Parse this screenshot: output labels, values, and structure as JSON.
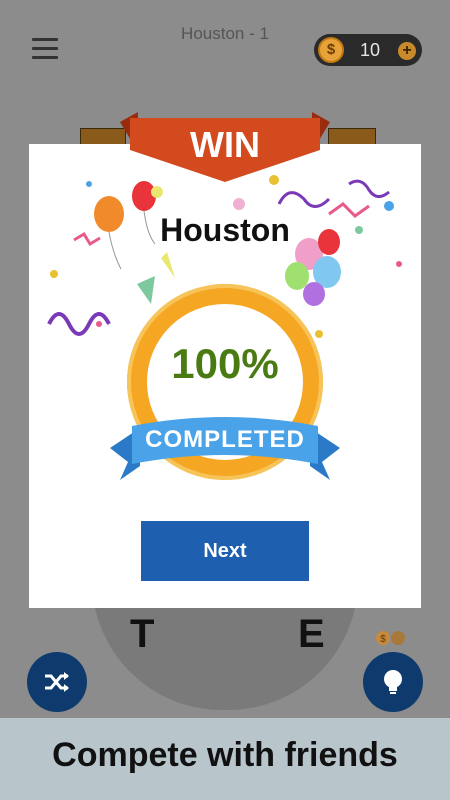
{
  "header": {
    "level_title": "Houston - 1",
    "coin_symbol": "$",
    "coin_count": "10",
    "add_coins_symbol": "+"
  },
  "board": {
    "letters": [
      "T",
      "E"
    ]
  },
  "dialog": {
    "ribbon_label": "WIN",
    "city_name": "Houston",
    "progress_percent": 100,
    "progress_text": "100%",
    "completed_label": "COMPLETED",
    "next_button_label": "Next"
  },
  "controls": {
    "shuffle_icon": "shuffle-icon",
    "hint_icon": "lightbulb-icon"
  },
  "footer": {
    "tagline": "Compete with friends"
  },
  "colors": {
    "ribbon": "#d24a1e",
    "ring": "#f5a623",
    "banner": "#4aa3e8",
    "next_button": "#1e5fb0",
    "percent_text": "#4a7a12"
  }
}
